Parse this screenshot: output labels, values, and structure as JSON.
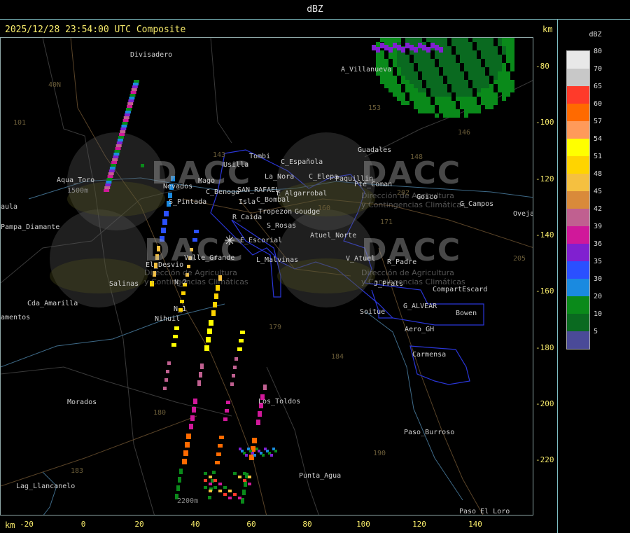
{
  "header": {
    "title": "dBZ"
  },
  "timestamp": "2025/12/28 23:54:00 UTC Composite",
  "axes": {
    "unit": "km",
    "x_ticks": [
      "-20",
      "0",
      "20",
      "40",
      "60",
      "80",
      "100",
      "120",
      "140"
    ],
    "y_ticks": [
      "-80",
      "-100",
      "-120",
      "-140",
      "-160",
      "-180",
      "-200",
      "-220"
    ]
  },
  "legend": {
    "title": "dBZ",
    "entries": [
      {
        "label": "80",
        "color": "#e8e8e8"
      },
      {
        "label": "70",
        "color": "#c8c8c8"
      },
      {
        "label": "65",
        "color": "#ff3a2a"
      },
      {
        "label": "60",
        "color": "#ff6a00"
      },
      {
        "label": "57",
        "color": "#ff9a5a"
      },
      {
        "label": "54",
        "color": "#ffff00"
      },
      {
        "label": "51",
        "color": "#ffd400"
      },
      {
        "label": "48",
        "color": "#f5c040"
      },
      {
        "label": "45",
        "color": "#d98a3a"
      },
      {
        "label": "42",
        "color": "#c06090"
      },
      {
        "label": "39",
        "color": "#d0189a"
      },
      {
        "label": "36",
        "color": "#8020d0"
      },
      {
        "label": "35",
        "color": "#2a50ff"
      },
      {
        "label": "30",
        "color": "#1a8ae0"
      },
      {
        "label": "20",
        "color": "#0a8a1a"
      },
      {
        "label": "10",
        "color": "#0a6a20"
      },
      {
        "label": "5",
        "color": "#4a4a98"
      }
    ]
  },
  "places": [
    "Divisadero",
    "A_Villanueva",
    "Guadales",
    "Usilla",
    "C_Española",
    "Tombi",
    "La_Nora",
    "C_Elepa",
    "Paquillin",
    "Pte_Coman",
    "Goico",
    "G_Campos",
    "Aqua_Toro",
    "Ovejas",
    "Pampa_Diamante",
    "S_Pintada",
    "Nevados",
    "C_Benoga",
    "SAN_RAFAEL",
    "E_Algarrobal",
    "C_Bombal",
    "R_Caida",
    "Tropezon",
    "Goudge",
    "S_Rosas",
    "E_Escorial",
    "Atuel_Norte",
    "Valle_Grande",
    "L_Malvinas",
    "V_Atuel",
    "R_Padre",
    "El_Desvio",
    "Salinas",
    "J_Prats",
    "CompartEscard",
    "G_ALVEAR",
    "Soitue",
    "Bowen",
    "Cda_Amarilla",
    "N_1",
    "N_2",
    "Nihuil",
    "Aero_GH",
    "Carmensa",
    "Morados",
    "Los_Toldos",
    "Paso_Burroso",
    "Punta_Agua",
    "Lag_Llancanelo",
    "Paso_El_Loro",
    "Mago",
    "Isla",
    "amentos",
    "aula"
  ],
  "routes": [
    "40N",
    "101",
    "143",
    "153",
    "146",
    "148",
    "202",
    "171",
    "180",
    "184",
    "179",
    "190",
    "183",
    "160",
    "205"
  ],
  "watermark": {
    "brand": "DACC",
    "line1": "Dirección de Agricultura",
    "line2": "y Contingencias Climáticas"
  },
  "terrain_labels": [
    "1500m",
    "2200m"
  ]
}
